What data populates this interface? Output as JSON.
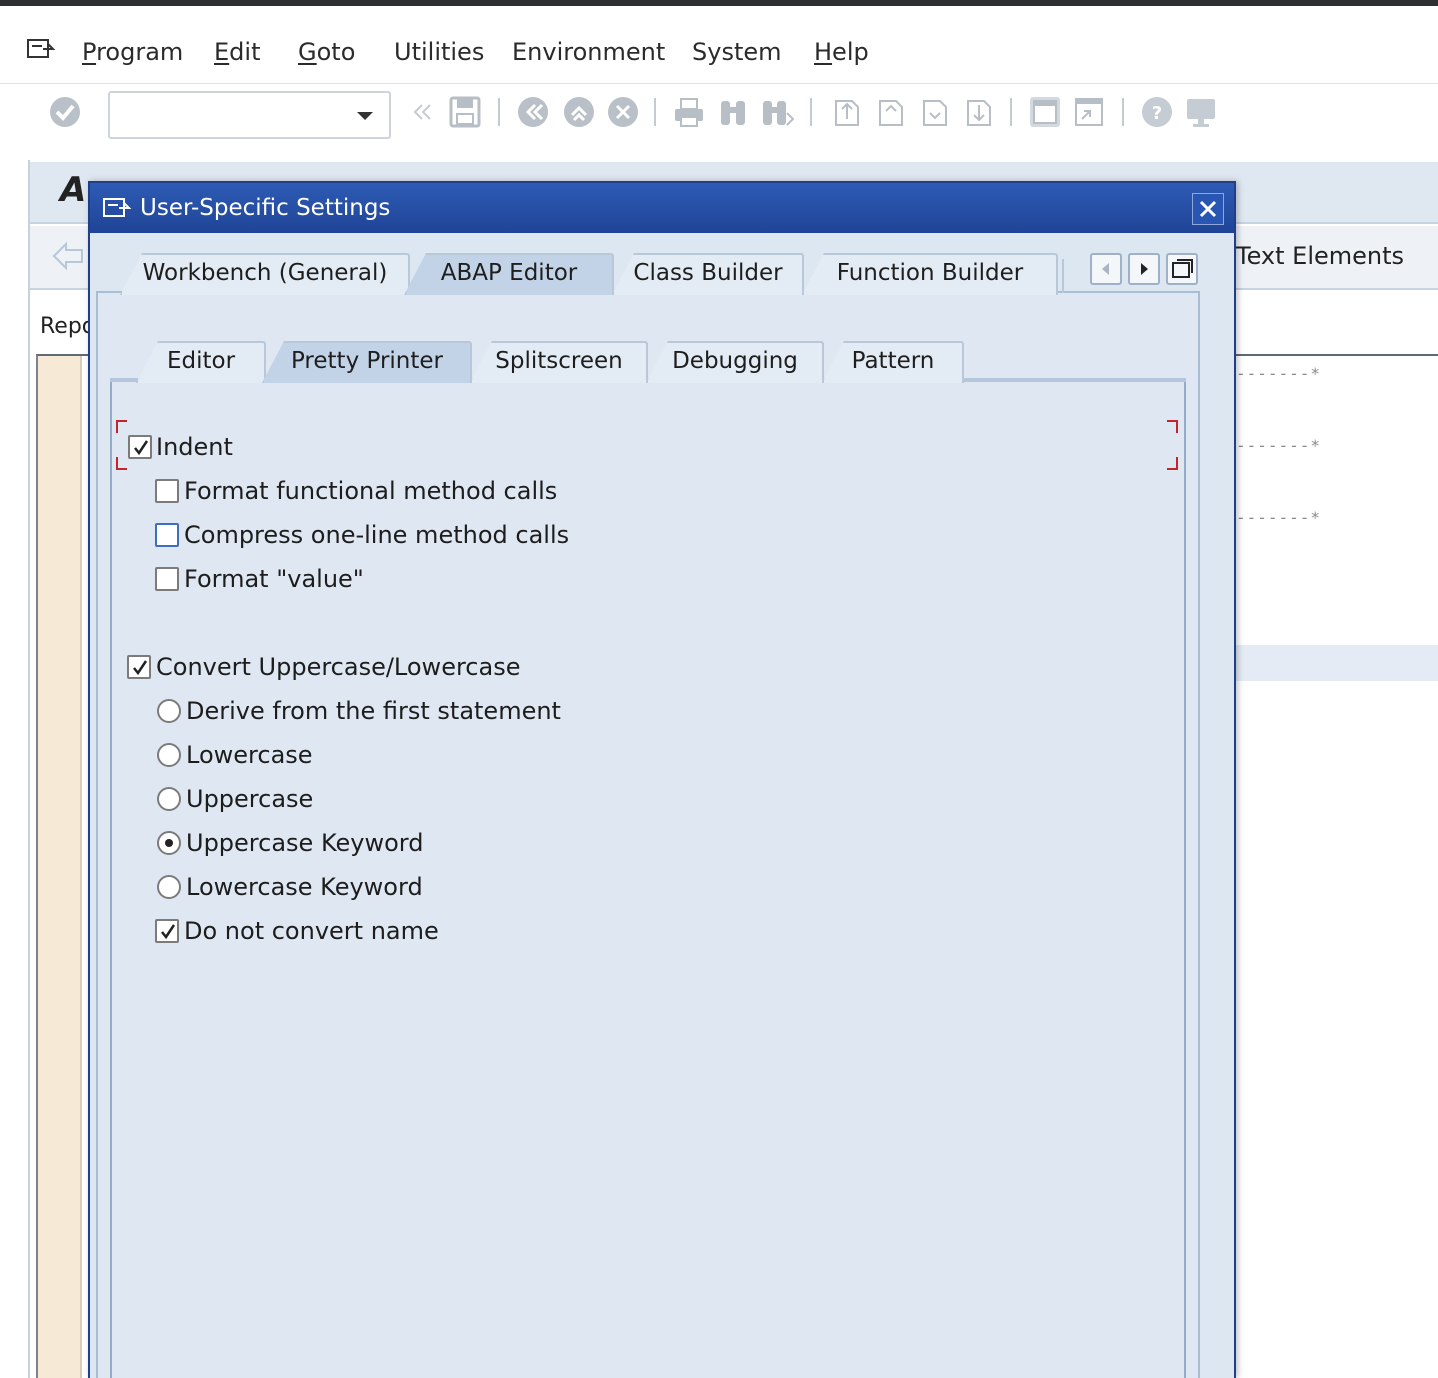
{
  "menubar": {
    "items": [
      {
        "label": "Program",
        "ul": "P"
      },
      {
        "label": "Edit",
        "ul": "E"
      },
      {
        "label": "Goto",
        "ul": "G"
      },
      {
        "label": "Utilities",
        "ul": ""
      },
      {
        "label": "Environment",
        "ul": ""
      },
      {
        "label": "System",
        "ul": ""
      },
      {
        "label": "Help",
        "ul": "H"
      }
    ]
  },
  "background": {
    "title_fragment": "A",
    "text_elements": "Text Elements",
    "report_fragment": "Repo"
  },
  "dialog": {
    "title": "User-Specific Settings",
    "tabs": [
      {
        "label": "Workbench (General)",
        "active": false
      },
      {
        "label": "ABAP Editor",
        "active": true
      },
      {
        "label": "Class Builder",
        "active": false
      },
      {
        "label": "Function Builder",
        "active": false
      }
    ],
    "subtabs": [
      {
        "label": "Editor",
        "active": false
      },
      {
        "label": "Pretty Printer",
        "active": true
      },
      {
        "label": "Splitscreen",
        "active": false
      },
      {
        "label": "Debugging",
        "active": false
      },
      {
        "label": "Pattern",
        "active": false
      }
    ],
    "options": {
      "indent": {
        "label": "Indent",
        "checked": true
      },
      "format_functional": {
        "label": "Format functional method calls",
        "checked": false
      },
      "compress_oneline": {
        "label": "Compress one-line method calls",
        "checked": false
      },
      "format_value": {
        "label": "Format \"value\"",
        "checked": false
      },
      "convert_case": {
        "label": "Convert Uppercase/Lowercase",
        "checked": true
      },
      "derive_first": {
        "label": "Derive from the first statement",
        "selected": false
      },
      "lowercase": {
        "label": "Lowercase",
        "selected": false
      },
      "uppercase": {
        "label": "Uppercase",
        "selected": false
      },
      "uppercase_keyword": {
        "label": "Uppercase Keyword",
        "selected": true
      },
      "lowercase_keyword": {
        "label": "Lowercase Keyword",
        "selected": false
      },
      "do_not_convert": {
        "label": "Do not convert name",
        "checked": true
      }
    }
  },
  "colors": {
    "dialog_title_bar": "#1f4496",
    "dialog_background": "#dde7f2",
    "active_tab": "#c2d3e8",
    "focus_bracket": "#c0262c"
  }
}
